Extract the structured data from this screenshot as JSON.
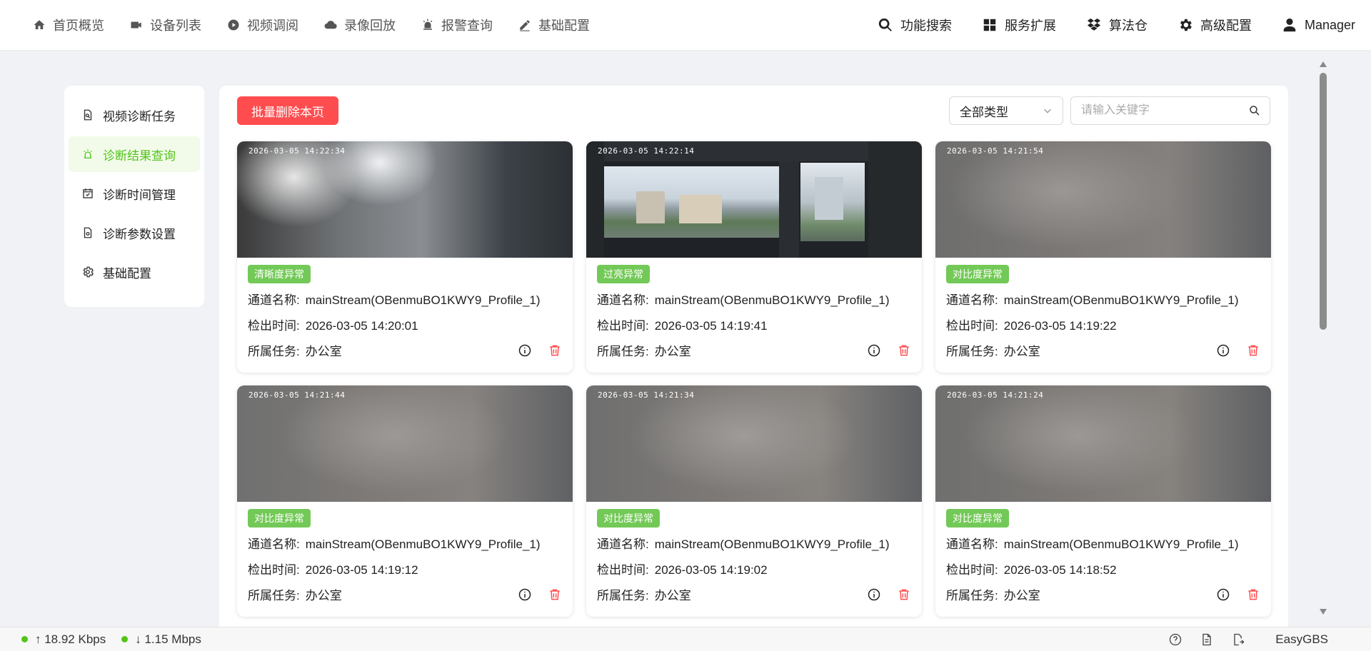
{
  "nav": {
    "left": [
      {
        "label": "首页概览",
        "icon": "home-icon"
      },
      {
        "label": "设备列表",
        "icon": "camera-icon"
      },
      {
        "label": "视频调阅",
        "icon": "play-circle-icon"
      },
      {
        "label": "录像回放",
        "icon": "cloud-icon"
      },
      {
        "label": "报警查询",
        "icon": "alarm-icon"
      },
      {
        "label": "基础配置",
        "icon": "pen-icon"
      }
    ],
    "right": [
      {
        "label": "功能搜索",
        "icon": "search-icon"
      },
      {
        "label": "服务扩展",
        "icon": "grid-icon"
      },
      {
        "label": "算法仓",
        "icon": "dropbox-icon"
      },
      {
        "label": "高级配置",
        "icon": "gear-icon"
      },
      {
        "label": "Manager",
        "icon": "user-icon"
      }
    ]
  },
  "sidebar": {
    "items": [
      {
        "label": "视频诊断任务",
        "icon": "doc-search-icon",
        "active": false
      },
      {
        "label": "诊断结果查询",
        "icon": "alarm-light-icon",
        "active": true
      },
      {
        "label": "诊断时间管理",
        "icon": "calendar-check-icon",
        "active": false
      },
      {
        "label": "诊断参数设置",
        "icon": "doc-settings-icon",
        "active": false
      },
      {
        "label": "基础配置",
        "icon": "gear-icon",
        "active": false
      }
    ]
  },
  "toolbar": {
    "batch_delete_label": "批量删除本页",
    "type_select_value": "全部类型",
    "search_placeholder": "请输入关键字"
  },
  "labels": {
    "channel": "通道名称:",
    "detected": "检出时间:",
    "task": "所属任务:"
  },
  "cards": [
    {
      "timestamp": "2026-03-05  14:22:34",
      "tag": "清晰度异常",
      "channel": "mainStream(OBenmuBO1KWY9_Profile_1)",
      "time": "2026-03-05 14:20:01",
      "task": "办公室",
      "scene": "blurry-light"
    },
    {
      "timestamp": "2026-03-05  14:22:14",
      "tag": "过亮异常",
      "channel": "mainStream(OBenmuBO1KWY9_Profile_1)",
      "time": "2026-03-05 14:19:41",
      "task": "办公室",
      "scene": "window-view"
    },
    {
      "timestamp": "2026-03-05  14:21:54",
      "tag": "对比度异常",
      "channel": "mainStream(OBenmuBO1KWY9_Profile_1)",
      "time": "2026-03-05 14:19:22",
      "task": "办公室",
      "scene": "gray-blur"
    },
    {
      "timestamp": "2026-03-05  14:21:44",
      "tag": "对比度异常",
      "channel": "mainStream(OBenmuBO1KWY9_Profile_1)",
      "time": "2026-03-05 14:19:12",
      "task": "办公室",
      "scene": "gray-blur"
    },
    {
      "timestamp": "2026-03-05  14:21:34",
      "tag": "对比度异常",
      "channel": "mainStream(OBenmuBO1KWY9_Profile_1)",
      "time": "2026-03-05 14:19:02",
      "task": "办公室",
      "scene": "gray-blur"
    },
    {
      "timestamp": "2026-03-05  14:21:24",
      "tag": "对比度异常",
      "channel": "mainStream(OBenmuBO1KWY9_Profile_1)",
      "time": "2026-03-05 14:18:52",
      "task": "办公室",
      "scene": "gray-blur"
    }
  ],
  "footer": {
    "upload_rate": "↑ 18.92 Kbps",
    "download_rate": "↓ 1.15 Mbps",
    "brand": "EasyGBS"
  },
  "colors": {
    "accent_green": "#52c41a",
    "tag_green": "#73c957",
    "danger_red": "#ff4d4f"
  }
}
